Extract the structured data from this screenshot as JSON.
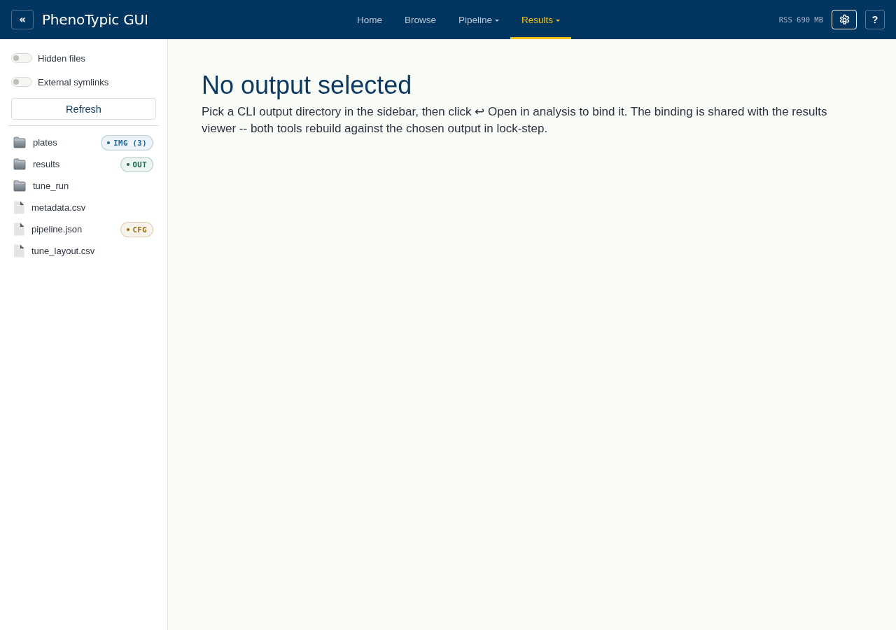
{
  "header": {
    "collapse_label": "«",
    "title": "PhenoTypic GUI",
    "nav": [
      {
        "label": "Home",
        "selected": false,
        "dropdown": false
      },
      {
        "label": "Browse",
        "selected": false,
        "dropdown": false
      },
      {
        "label": "Pipeline",
        "selected": false,
        "dropdown": true
      },
      {
        "label": "Results",
        "selected": true,
        "dropdown": true
      }
    ],
    "memory": "RSS 690 MB",
    "help_label": "?"
  },
  "sidebar": {
    "toggles": [
      {
        "label": "Hidden files",
        "on": false
      },
      {
        "label": "External symlinks",
        "on": false
      }
    ],
    "refresh_label": "Refresh",
    "files": [
      {
        "name": "plates",
        "kind": "folder",
        "badge": {
          "label": "IMG (3)",
          "color": "#1d6592"
        }
      },
      {
        "name": "results",
        "kind": "folder",
        "badge": {
          "label": "OUT",
          "color": "#16694a"
        }
      },
      {
        "name": "tune_run",
        "kind": "folder"
      },
      {
        "name": "metadata.csv",
        "kind": "file"
      },
      {
        "name": "pipeline.json",
        "kind": "file",
        "badge": {
          "label": "CFG",
          "color": "#9a6a08"
        }
      },
      {
        "name": "tune_layout.csv",
        "kind": "file"
      }
    ]
  },
  "main": {
    "heading": "No output selected",
    "text": "Pick a CLI output directory in the sidebar, then click ↩ Open in analysis to bind it. The binding is shared with the results viewer -- both tools rebuild against the chosen output in lock-step."
  }
}
